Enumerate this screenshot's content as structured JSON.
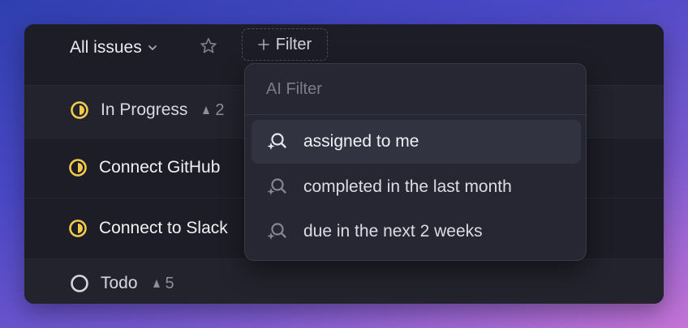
{
  "header": {
    "view_title": "All issues",
    "filter_label": "Filter"
  },
  "groups": [
    {
      "label": "In Progress",
      "count": "2"
    },
    {
      "label": "Todo",
      "count": "5"
    }
  ],
  "issues": [
    {
      "title": "Connect GitHub"
    },
    {
      "title": "Connect to Slack"
    }
  ],
  "filter_menu": {
    "search_placeholder": "AI Filter",
    "items": [
      {
        "label": "assigned to me"
      },
      {
        "label": "completed in the last month"
      },
      {
        "label": "due in the next 2 weeks"
      }
    ]
  },
  "colors": {
    "in_progress": "#f2c94c",
    "todo": "#d5d6dd",
    "background_start": "#2f3fae",
    "background_end": "#c574d6"
  },
  "icons": [
    "chevron-down-icon",
    "star-icon",
    "plus-icon",
    "in-progress-status-icon",
    "todo-status-icon",
    "priority-icon",
    "ai-search-icon"
  ]
}
